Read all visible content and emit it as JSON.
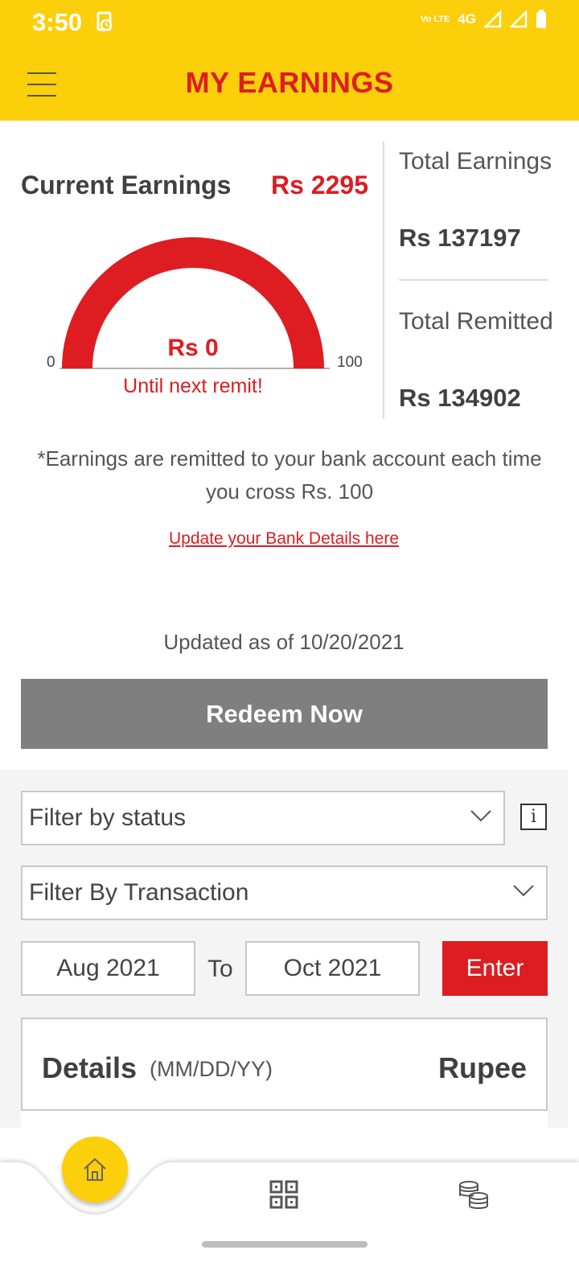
{
  "status_bar": {
    "time": "3:50",
    "volte": "Vo LTE",
    "network": "4G"
  },
  "header": {
    "title": "MY EARNINGS"
  },
  "current": {
    "label": "Current Earnings",
    "value": "Rs 2295"
  },
  "gauge": {
    "min_label": "0",
    "max_label": "100",
    "value_label": "Rs 0",
    "caption": "Until next remit!",
    "level": 0,
    "color": "#dd1d21"
  },
  "totals": {
    "earnings_label": "Total Earnings",
    "earnings_value": "Rs 137197",
    "remitted_label": "Total Remitted",
    "remitted_value": "Rs 134902"
  },
  "note": "*Earnings are remitted to your bank account each time you cross Rs. 100",
  "bank_link": "Update your Bank Details here",
  "updated": "Updated as of 10/20/2021",
  "redeem_label": "Redeem Now",
  "filters": {
    "status_placeholder": "Filter by status",
    "transaction_placeholder": "Filter By Transaction",
    "info_glyph": "i",
    "from_date": "Aug 2021",
    "to_label": "To",
    "to_date": "Oct 2021",
    "enter_label": "Enter"
  },
  "details": {
    "title": "Details",
    "format": "(MM/DD/YY)",
    "currency": "Rupee"
  },
  "nav": {
    "icons": [
      "home-icon",
      "qr-code-icon",
      "coins-icon"
    ]
  },
  "colors": {
    "brand_yellow": "#fbcf0a",
    "brand_red": "#dd1d21",
    "button_gray": "#7f7f7f"
  }
}
